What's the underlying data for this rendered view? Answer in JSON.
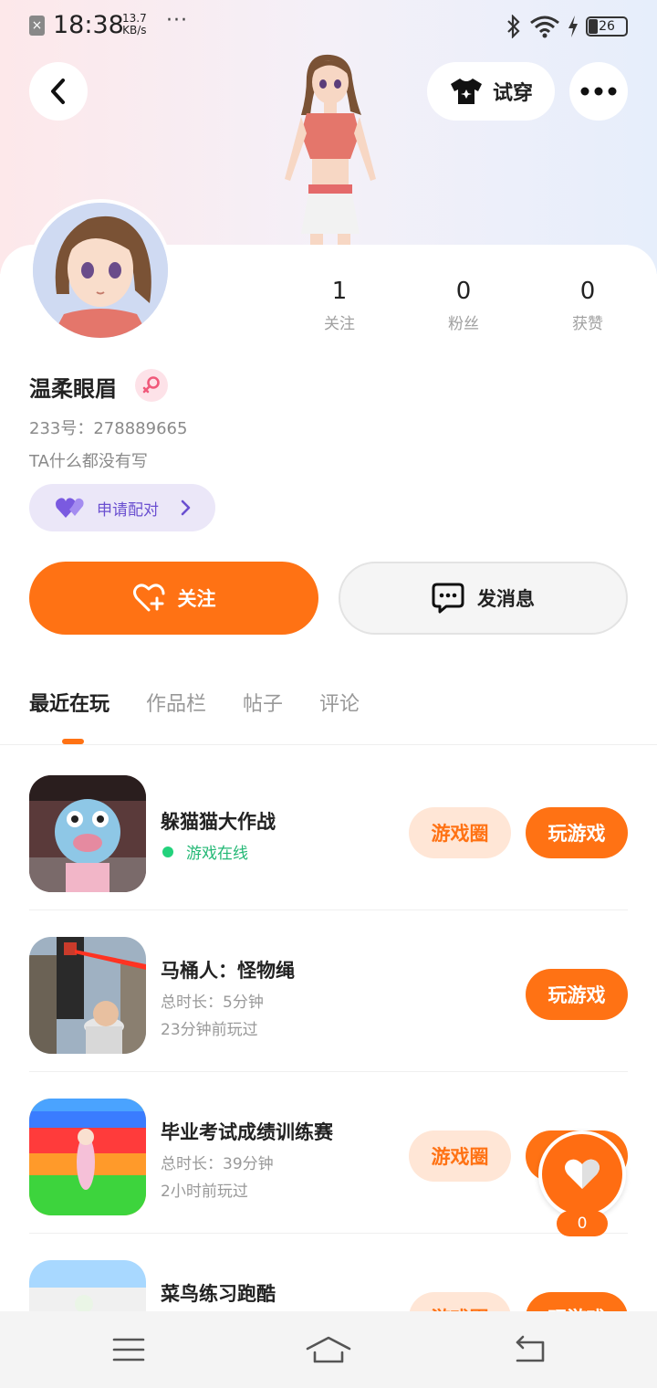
{
  "status_bar": {
    "time": "18:38",
    "net_speed_value": "13.7",
    "net_speed_unit": "KB/s",
    "more": "···",
    "battery_level": "26",
    "icons": [
      "close-icon",
      "bluetooth-icon",
      "wifi-icon",
      "charging-icon",
      "battery-icon"
    ]
  },
  "header": {
    "back_icon": "chevron-left-icon",
    "tryon_label": "试穿",
    "tryon_icon": "tshirt-icon",
    "more_icon": "more-dots-icon"
  },
  "profile": {
    "name": "温柔眼眉",
    "gender_icon": "female-icon",
    "uid": "233号：278889665",
    "bio": "TA什么都没有写",
    "pair_label": "申请配对",
    "stats": [
      {
        "num": "1",
        "label": "关注"
      },
      {
        "num": "0",
        "label": "粉丝"
      },
      {
        "num": "0",
        "label": "获赞"
      }
    ]
  },
  "actions": {
    "follow_label": "关注",
    "message_label": "发消息"
  },
  "tabs": [
    {
      "label": "最近在玩",
      "active": true
    },
    {
      "label": "作品栏",
      "active": false
    },
    {
      "label": "帖子",
      "active": false
    },
    {
      "label": "评论",
      "active": false
    }
  ],
  "games": [
    {
      "title": "躲猫猫大作战",
      "status": "游戏在线",
      "circle_label": "游戏圈",
      "play_label": "玩游戏"
    },
    {
      "title": "马桶人：怪物绳",
      "duration": "总时长：5分钟",
      "last_played": "23分钟前玩过",
      "play_label": "玩游戏"
    },
    {
      "title": "毕业考试成绩训练赛",
      "duration": "总时长：39分钟",
      "last_played": "2小时前玩过",
      "circle_label": "游戏圈",
      "play_label": "玩游戏"
    },
    {
      "title": "菜鸟练习跑酷",
      "circle_label": "游戏圈",
      "play_label": "玩游戏"
    }
  ],
  "like": {
    "count": "0"
  },
  "colors": {
    "accent": "#ff7214",
    "online": "#23b875",
    "pair": "#6a4fd0"
  }
}
